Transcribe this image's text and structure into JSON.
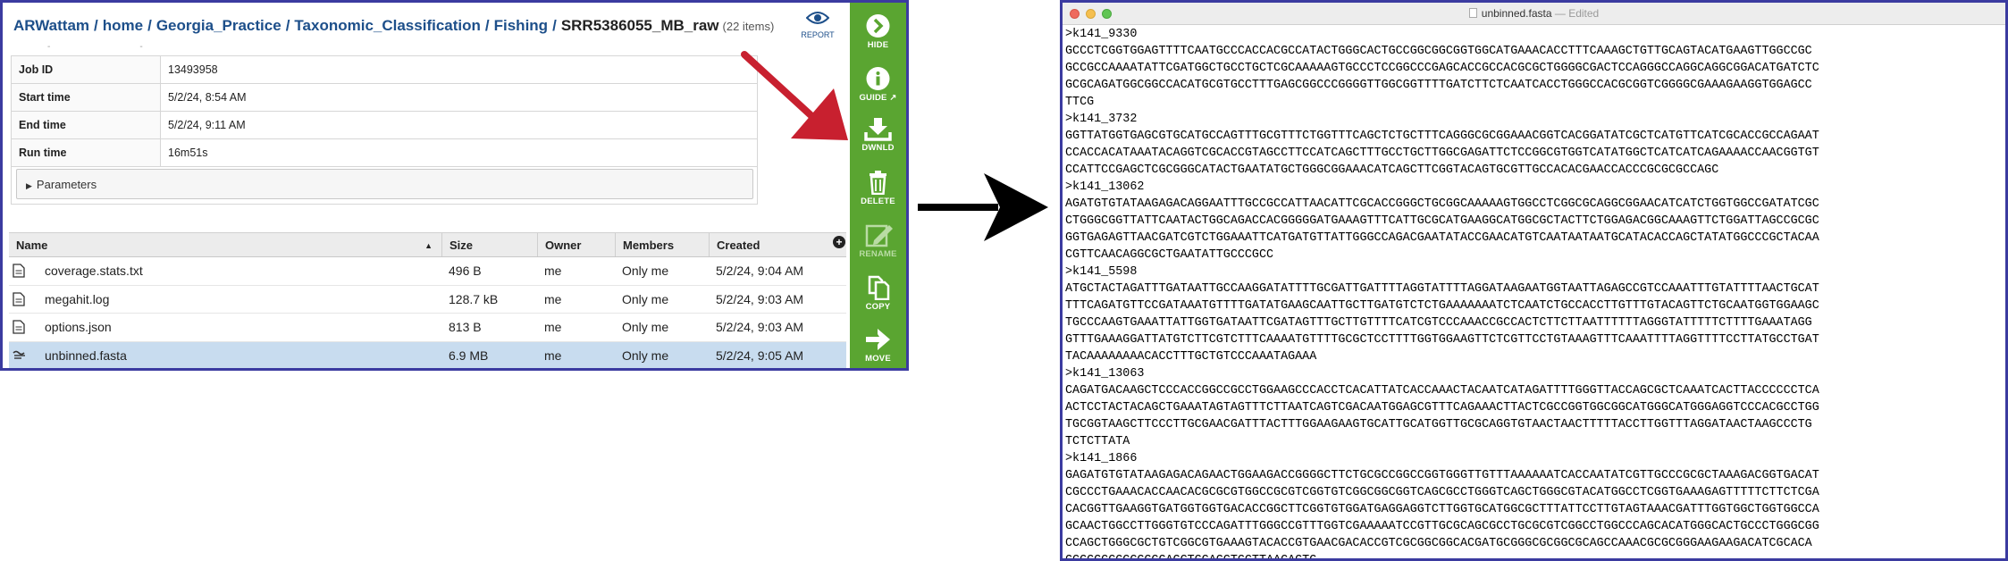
{
  "left": {
    "breadcrumb": {
      "items": [
        "ARWattam",
        "home",
        "Georgia_Practice",
        "Taxonomic_Classification",
        "Fishing"
      ],
      "current": "SRR5386055_MB_raw",
      "count": "(22 items)"
    },
    "report_label": "REPORT",
    "meta": [
      {
        "key": "Job ID",
        "value": "13493958"
      },
      {
        "key": "Start time",
        "value": "5/2/24, 8:54 AM"
      },
      {
        "key": "End time",
        "value": "5/2/24, 9:11 AM"
      },
      {
        "key": "Run time",
        "value": "16m51s"
      }
    ],
    "parameters_label": "Parameters",
    "columns": {
      "name": "Name",
      "size": "Size",
      "owner": "Owner",
      "members": "Members",
      "created": "Created"
    },
    "files": [
      {
        "icon": "document-icon",
        "name": "coverage.stats.txt",
        "size": "496 B",
        "owner": "me",
        "members": "Only me",
        "created": "5/2/24, 9:04 AM"
      },
      {
        "icon": "document-icon",
        "name": "megahit.log",
        "size": "128.7 kB",
        "owner": "me",
        "members": "Only me",
        "created": "5/2/24, 9:03 AM"
      },
      {
        "icon": "document-icon",
        "name": "options.json",
        "size": "813 B",
        "owner": "me",
        "members": "Only me",
        "created": "5/2/24, 9:03 AM"
      },
      {
        "icon": "fasta-icon",
        "name": "unbinned.fasta",
        "size": "6.9 MB",
        "owner": "me",
        "members": "Only me",
        "created": "5/2/24, 9:05 AM"
      }
    ],
    "sidebar": [
      {
        "label": "HIDE",
        "icon": "chevron-right-circle-icon",
        "enabled": true
      },
      {
        "label": "GUIDE",
        "icon": "info-circle-icon",
        "enabled": true
      },
      {
        "label": "DWNLD",
        "icon": "download-icon",
        "enabled": true
      },
      {
        "label": "DELETE",
        "icon": "trash-icon",
        "enabled": true
      },
      {
        "label": "RENAME",
        "icon": "pencil-icon",
        "enabled": false
      },
      {
        "label": "COPY",
        "icon": "copy-icon",
        "enabled": true
      },
      {
        "label": "MOVE",
        "icon": "arrow-right-icon",
        "enabled": true
      }
    ],
    "colors": {
      "sidebar": "#5aa531",
      "link": "#1d4f8a",
      "selected_row": "#c8dcef",
      "annotation_arrow": "#c8202f"
    }
  },
  "right": {
    "window_title": "unbinned.fasta",
    "window_status": "— Edited",
    "text": ">k141_9330\nGCCCTCGGTGGAGTTTTCAATGCCCACCACGCCATACTGGGCACTGCCGGCGGCGGTGGCATGAAACACCTTTCAAAGCTGTTGCAGTACATGAAGTTGGCCGC\nGCCGCCAAAATATTCGATGGCTGCCTGCTCGCAAAAAGTGCCCTCCGGCCCGAGCACCGCCACGCGCTGGGGCGACTCCAGGGCCAGGCAGGCGGACATGATCTC\nGCGCAGATGGCGGCCACATGCGTGCCTTTGAGCGGCCCGGGGTTGGCGGTTTTGATCTTCTCAATCACCTGGGCCACGCGGTCGGGGCGAAAGAAGGTGGAGCC\nTTCG\n>k141_3732\nGGTTATGGTGAGCGTGCATGCCAGTTTGCGTTTCTGGTTTCAGCTCTGCTTTCAGGGCGCGGAAACGGTCACGGATATCGCTCATGTTCATCGCACCGCCAGAAT\nCCACCACATAAATACAGGTCGCACCGTAGCCTTCCATCAGCTTTGCCTGCTTGGCGAGATTCTCCGGCGTGGTCATATGGCTCATCATCAGAAAACCAACGGTGT\nCCATTCCGAGCTCGCGGGCATACTGAATATGCTGGGCGGAAACATCAGCTTCGGTACAGTGCGTTGCCACACGAACCACCCGCGCGCCAGC\n>k141_13062\nAGATGTGTATAAGAGACAGGAATTTGCCGCCATTAACATTCGCACCGGGCTGCGGCAAAAAGTGGCCTCGGCGCAGGCGGAACATCATCTGGTGGCCGATATCGC\nCTGGGCGGTTATTCAATACTGGCAGACCACGGGGGATGAAAGTTTCATTGCGCATGAAGGCATGGCGCTACTTCTGGAGACGGCAAAGTTCTGGATTAGCCGCGC\nGGTGAGAGTTAACGATCGTCTGGAAATTCATGATGTTATTGGGCCAGACGAATATACCGAACATGTCAATAATAATGCATACACCAGCTATATGGCCCGCTACAA\nCGTTCAACAGGCGCTGAATATTGCCCGCC\n>k141_5598\nATGCTACTAGATTTGATAATTGCCAAGGATATTTTGCGATTGATTTTAGGTATTTTAGGATAAGAATGGTAATTAGAGCCGTCCAAATTTGTATTTTAACTGCAT\nTTTCAGATGTTCCGATAAATGTTTTGATATGAAGCAATTGCTTGATGTCTCTGAAAAAAATCTCAATCTGCCACCTTGTTTGTACAGTTCTGCAATGGTGGAAGC\nTGCCCAAGTGAAATTATTGGTGATAATTCGATAGTTTGCTTGTTTTCATCGTCCCAAACCGCCACTCTTCTTAATTTTTTAGGGTATTTTTCTTTTGAAATAGG\nGTTTGAAAGGATTATGTCTTCGTCTTTCAAAATGTTTTGCGCTCCTTTTGGTGGAAGTTCTCGTTCCTGTAAAGTTTCAAATTTTAGGTTTTCCTTATGCCTGAT\nTACAAAAAAAACACCTTTGCTGTCCCAAATAGAAA\n>k141_13063\nCAGATGACAAGCTCCCACCGGCCGCCTGGAAGCCCACCTCACATTATCACCAAACTACAATCATAGATTTTGGGTTACCAGCGCTCAAATCACTTACCCCCCTCA\nACTCCTACTACAGCTGAAATAGTAGTTTCTTAATCAGTCGACAATGGAGCGTTTCAGAAACTTACTCGCCGGTGGCGGCATGGGCATGGGAGGTCCCACGCCTGG\nTGCGGTAAGCTTCCCTTGCGAACGATTTACTTTGGAAGAAGTGCATTGCATGGTTGCGCAGGTGTAACTAACTTTTTACCTTGGTTTAGGATAACTAAGCCCTG\nTCTCTTATA\n>k141_1866\nGAGATGTGTATAAGAGACAGAACTGGAAGACCGGGGCTTCTGCGCCGGCCGGTGGGTTGTTTAAAAAATCACCAATATCGTTGCCCGCGCTAAAGACGGTGACAT\nCGCCCTGAAACACCAACACGCGCGTGGCCGCGTCGGTGTCGGCGGCGGTCAGCGCCTGGGTCAGCTGGGCGTACATGGCCTCGGTGAAAGAGTTTTTCTTCTCGA\nCACGGTTGAAGGTGATGGTGGTGACACCGGCTTCGGTGTGGATGAGGAGGTCTTGGTGCATGGCGCTTTATTCCTTGTAGTAAACGATTTGGTGGCTGGTGGCCA\nGCAACTGGCCTTGGGTGTCCCAGATTTGGGCCGTTTGGTCGAAAAATCCGTTGCGCAGCGCCTGCGCGTCGGCCTGGCCCAGCACATGGGCACTGCCCTGGGCGG\nCCAGCTGGGCGCTGTCGGCGTGAAAGTACACCGTGAACGACACCGTCGCGGCGGCACGATGCGGGCGCGGCGCAGCCAAACGCGCGGGAAGAAGACATCGCACA\nGCGGGCCGCCGGCGAGCTGCAGCTGCTTAACAGTG"
  }
}
